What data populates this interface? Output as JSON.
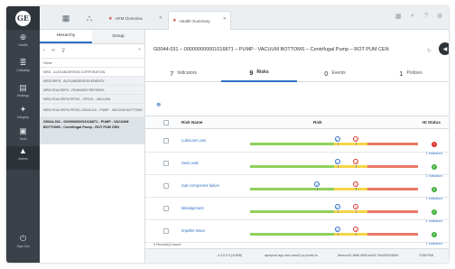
{
  "nav": {
    "logo_text": "GE",
    "items": [
      {
        "icon": "globe-icon",
        "glyph": "⊕",
        "label": "Health"
      },
      {
        "icon": "layers-icon",
        "glyph": "≣",
        "label": "Criticality"
      },
      {
        "icon": "wrench-icon",
        "glyph": "▤",
        "label": "Strategy"
      },
      {
        "icon": "integrity-icon",
        "glyph": "✦",
        "label": "Integrity"
      },
      {
        "icon": "tools-icon",
        "glyph": "▣",
        "label": "Tools"
      },
      {
        "icon": "admin-icon",
        "glyph": "▲",
        "label": "Admin"
      },
      {
        "icon": "signout-icon",
        "glyph": "⏻",
        "label": "Sign Out"
      }
    ]
  },
  "topbar": {
    "tabs": [
      {
        "icon": "apm-overview-icon",
        "label": "APM Overview"
      },
      {
        "icon": "health-summary-icon",
        "label": "Health Summary"
      }
    ]
  },
  "hierarchy": {
    "tabs": [
      "Hierarchy",
      "Group"
    ],
    "items": [
      "Home",
      "MRD - ALEXANDERSON CORPORATION",
      "MRD-REFN - ALEXANDERSON ENERGY",
      "MRD-ROA-REFN - ROANOKE REFINING",
      "MRD-ROA-REFN-RFG01 - RFG01 - VACUUM",
      "MRD-ROA-REFN-RFG01-G0044-01I - PUMP - VACUUM BOTTOMS"
    ],
    "selected": "G0044-031 - 000000000001016871 - PUMP - VACUUM BOTTOMS - Centrifugal Pump - ROT PUM CEN"
  },
  "main": {
    "title": "G0044-031 – 000000000001016871 – PUMP - VACUUM BOTTOMS – Centrifugal Pump – ROT PUM CEN",
    "kpis": [
      {
        "count": "7",
        "label": "Indicators"
      },
      {
        "count": "9",
        "label": "Risks"
      },
      {
        "count": "0",
        "label": "Events"
      },
      {
        "count": "1",
        "label": "Policies"
      }
    ],
    "columns": {
      "name": "Risk Name",
      "risk": "Risk",
      "status": "HI Status"
    },
    "rows": [
      {
        "name": "Lubricant Loss",
        "status": "bad",
        "count": "1 Indicators",
        "progress": 0.52,
        "warn": 0.63
      },
      {
        "name": "Seal Leak",
        "status": "ok",
        "count": "1 Indicators",
        "progress": 0.52,
        "warn": 0.63
      },
      {
        "name": "Sub-component failure",
        "status": "ok",
        "count": "1 Indicators",
        "progress": 0.4,
        "warn": 0.63
      },
      {
        "name": "Misalignment",
        "status": "ok",
        "count": "1 Indicators",
        "progress": 0.52,
        "warn": 0.63
      },
      {
        "name": "Impeller Wear",
        "status": "ok",
        "count": "1 Indicators",
        "progress": 0.52,
        "warn": 0.63
      }
    ],
    "records": "9 Record(s) found",
    "footer": {
      "version": "4.3.0.0.0 (11838)",
      "host": "apmprod.app.aws-usw02-pr.predix.io",
      "tenant": "5eeecc51-8fd5-4653-ba35-75a1502048d0",
      "id": "21587938"
    }
  }
}
